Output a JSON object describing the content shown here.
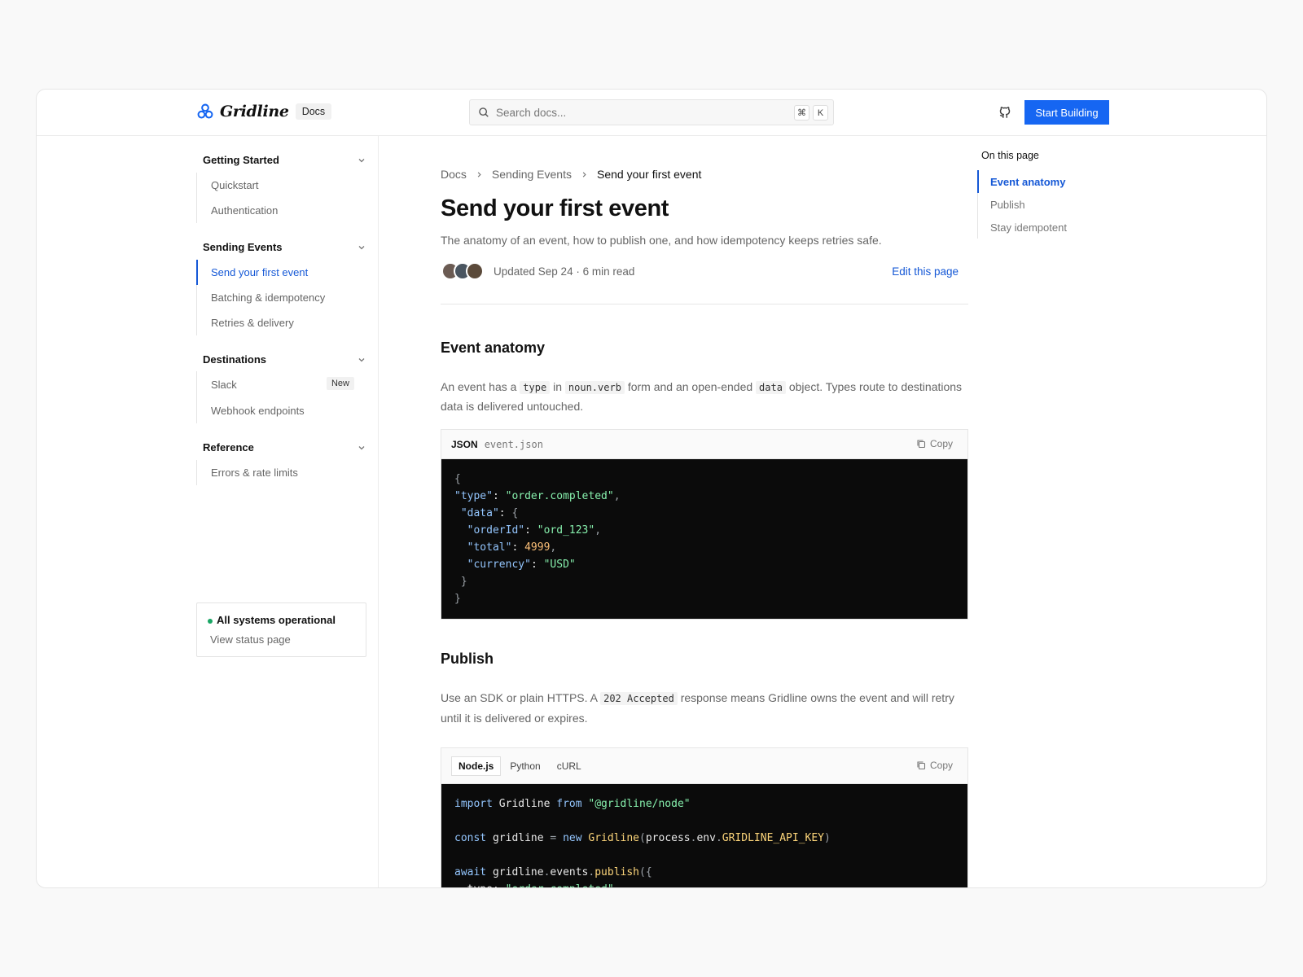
{
  "header": {
    "logo_text": "Gridline",
    "docs_badge": "Docs",
    "search_placeholder": "Search docs...",
    "shortcut_keys": [
      "⌘",
      "K"
    ],
    "cta_label": "Start Building"
  },
  "sidebar": {
    "sections": [
      {
        "title": "Getting Started",
        "items": [
          {
            "label": "Quickstart"
          },
          {
            "label": "Authentication"
          }
        ]
      },
      {
        "title": "Sending Events",
        "items": [
          {
            "label": "Send your first event",
            "active": true
          },
          {
            "label": "Batching & idempotency"
          },
          {
            "label": "Retries & delivery"
          }
        ]
      },
      {
        "title": "Destinations",
        "items": [
          {
            "label": "Slack",
            "badge": "New"
          },
          {
            "label": "Webhook endpoints"
          }
        ]
      },
      {
        "title": "Reference",
        "items": [
          {
            "label": "Errors & rate limits"
          }
        ]
      }
    ],
    "status": {
      "title": "All systems operational",
      "link": "View status page"
    }
  },
  "main": {
    "breadcrumb": [
      "Docs",
      "Sending Events",
      "Send your first event"
    ],
    "title": "Send your first event",
    "subtitle": "The anatomy of an event, how to publish one, and how idempotency keeps retries safe.",
    "meta": "Updated Sep 24 · 6 min read",
    "edit_link": "Edit this page",
    "section1": {
      "heading": "Event anatomy",
      "para_1": "An event has a",
      "code_1": "type",
      "para_2": "in",
      "code_2": "noun.verb",
      "para_3": "form and an open-ended",
      "code_3": "data",
      "para_4": "object. Types route to destinations data is delivered untouched.",
      "code_lang": "JSON",
      "code_file": "event.json",
      "copy_label": "Copy"
    },
    "section2": {
      "heading": "Publish",
      "para_1": "Use an SDK or plain HTTPS. A",
      "code_1": "202 Accepted",
      "para_2": "response means Gridline owns the event and will retry until it is delivered or expires.",
      "tabs": [
        "Node.js",
        "Python",
        "cURL"
      ],
      "copy_label": "Copy"
    }
  },
  "toc": {
    "title": "On this page",
    "items": [
      "Event anatomy",
      "Publish",
      "Stay idempotent"
    ]
  },
  "colors": {
    "accent": "#1666f2",
    "link": "#1558d6",
    "status_ok": "#19a664",
    "code_bg": "#0b0b0b"
  }
}
